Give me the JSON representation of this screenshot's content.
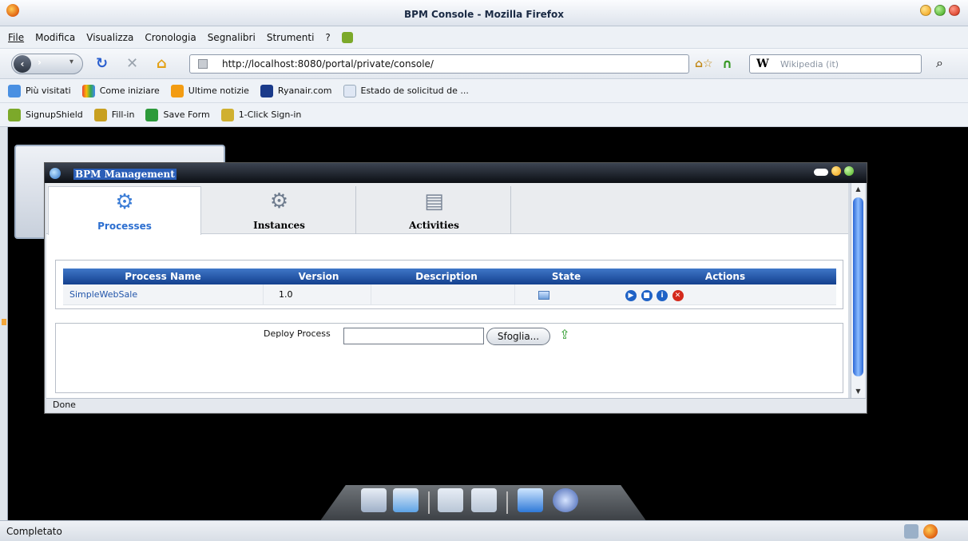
{
  "window": {
    "title": "BPM Console - Mozilla Firefox"
  },
  "menu": {
    "items": [
      "File",
      "Modifica",
      "Visualizza",
      "Cronologia",
      "Segnalibri",
      "Strumenti",
      "?"
    ]
  },
  "nav": {
    "url": "http://localhost:8080/portal/private/console/",
    "search_placeholder": "Wikipedia (it)",
    "search_engine": "W"
  },
  "bookmarks": [
    "Più visitati",
    "Come iniziare",
    "Ultime notizie",
    "Ryanair.com",
    "Estado de solicitud de ..."
  ],
  "toolbar2": [
    "SignupShield",
    "Fill-in",
    "Save Form",
    "1-Click Sign-in"
  ],
  "bpm": {
    "title": "BPM Management",
    "tabs": [
      {
        "label": "Processes",
        "icon": "gear-icon"
      },
      {
        "label": "Instances",
        "icon": "gears-icon"
      },
      {
        "label": "Activities",
        "icon": "document-gear-icon"
      }
    ],
    "table": {
      "headers": [
        "Process Name",
        "Version",
        "Description",
        "State",
        "Actions"
      ],
      "rows": [
        {
          "name": "SimpleWebSale",
          "version": "1.0",
          "description": ""
        }
      ],
      "actions": [
        "play",
        "stop",
        "info",
        "delete"
      ]
    },
    "deploy": {
      "label": "Deploy Process",
      "browse": "Sfoglia..."
    },
    "status": "Done"
  },
  "browser_status": "Completato",
  "colors": {
    "header_blue": "#1f4fa0",
    "link": "#2255aa",
    "accent": "#2d6fd0"
  }
}
